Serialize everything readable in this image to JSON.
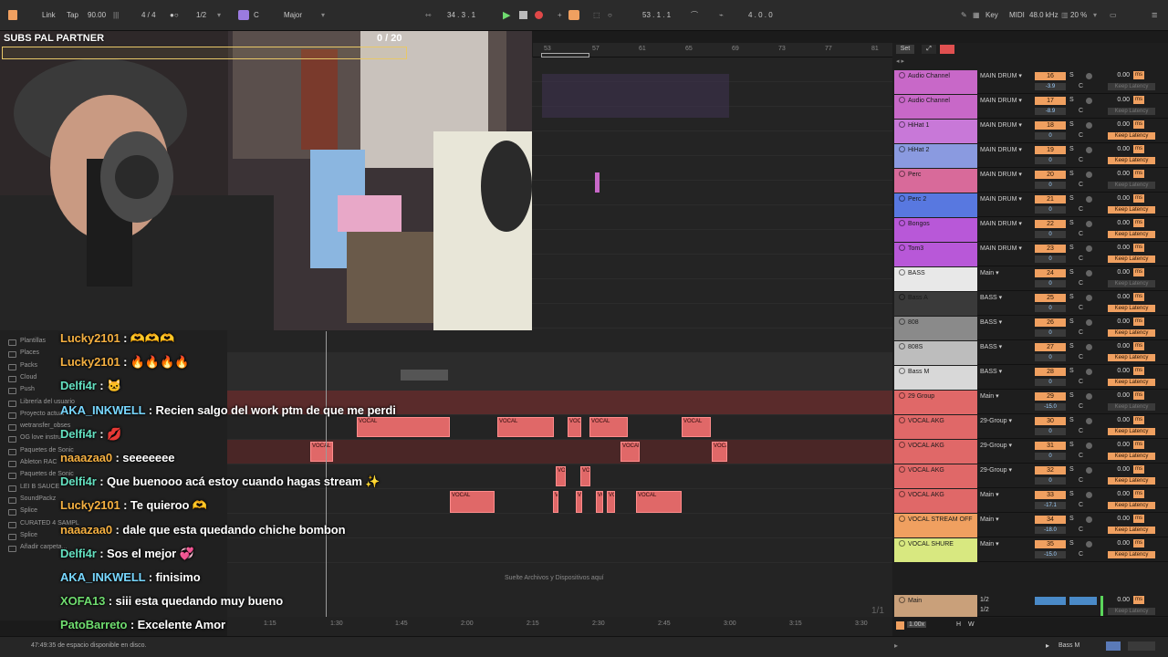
{
  "transport": {
    "link": "Link",
    "tap": "Tap",
    "tempo": "90.00",
    "signature": "4 / 4",
    "quantize": "1/2",
    "key_root": "C",
    "key_scale": "Major",
    "position": "34 .  3 .  1",
    "loop_start": "53 .  1 .  1",
    "loop_length": "4 .  0 .  0",
    "key_label": "Key",
    "midi_label": "MIDI",
    "sample_rate": "48.0 kHz",
    "cpu": "20 %"
  },
  "overlay": {
    "subs_goal": "SUBS PAL PARTNER",
    "subs_count": "0 / 20"
  },
  "ruler": [
    "53",
    "57",
    "61",
    "65",
    "69",
    "73",
    "77",
    "81"
  ],
  "set_label": "Set",
  "browser": {
    "items": [
      "Plantillas",
      "Places",
      "Packs",
      "Cloud",
      "Push",
      "Librería del usuario",
      "Proyecto actual",
      "wetransfer_obses",
      "OG love instru",
      "Paquetes de Sonic",
      "Ableton RAC",
      "Paquetes de Sonic",
      "LEI B SAUCE",
      "SoundPackz",
      "Splice",
      "CURATED 4 SAMPL",
      "Splice",
      "Añadir carpeta..."
    ]
  },
  "chat": [
    {
      "user": "Lucky2101",
      "msg": " : 🫶🫶🫶",
      "color": "o"
    },
    {
      "user": "Lucky2101",
      "msg": " : 🔥🔥🔥🔥",
      "color": "o"
    },
    {
      "user": "Delfi4r",
      "msg": " : 🐱",
      "color": "t"
    },
    {
      "user": "AKA_INKWELL",
      "msg": " : Recien salgo del work ptm de que me perdi",
      "color": ""
    },
    {
      "user": "Delfi4r",
      "msg": " : 💋",
      "color": "t"
    },
    {
      "user": "naaazaa0",
      "msg": " : seeeeeee",
      "color": "o"
    },
    {
      "user": "Delfi4r",
      "msg": " : Que buenooo acá estoy cuando hagas stream ✨",
      "color": "t"
    },
    {
      "user": "Lucky2101",
      "msg": " : Te quieroo 🫶",
      "color": "o"
    },
    {
      "user": "naaazaa0",
      "msg": " : dale que esta quedando chiche bombon",
      "color": "o"
    },
    {
      "user": "Delfi4r",
      "msg": " : Sos el mejor 💞",
      "color": "t"
    },
    {
      "user": "AKA_INKWELL",
      "msg": " : finisimo",
      "color": ""
    },
    {
      "user": "XOFA13",
      "msg": " : siii esta quedando muy bueno",
      "color": "g"
    },
    {
      "user": "PatoBarreto",
      "msg": " : Excelente Amor",
      "color": "g"
    }
  ],
  "tracks": [
    {
      "name": "Audio Channel",
      "color": "#c868c8",
      "route": "MAIN DRUM",
      "num": "16",
      "sub": "-3.9",
      "vol": "0.00",
      "latency": "Keep Latency",
      "klon": false
    },
    {
      "name": "Audio Channel",
      "color": "#c868c8",
      "route": "MAIN DRUM",
      "num": "17",
      "sub": "-8.9",
      "vol": "0.00",
      "latency": "Keep Latency",
      "klon": false
    },
    {
      "name": "HiHat 1",
      "color": "#c878d8",
      "route": "MAIN DRUM",
      "num": "18",
      "sub": "0",
      "vol": "0.00",
      "latency": "Keep Latency",
      "klon": true
    },
    {
      "name": "HiHat 2",
      "color": "#8a9ae0",
      "route": "MAIN DRUM",
      "num": "19",
      "sub": "0",
      "vol": "0.00",
      "latency": "Keep Latency",
      "klon": true
    },
    {
      "name": "Perc",
      "color": "#d86a9a",
      "route": "MAIN DRUM",
      "num": "20",
      "sub": "0",
      "vol": "0.00",
      "latency": "Keep Latency",
      "klon": false
    },
    {
      "name": "Perc 2",
      "color": "#5878e0",
      "route": "MAIN DRUM",
      "num": "21",
      "sub": "0",
      "vol": "0.00",
      "latency": "Keep Latency",
      "klon": true
    },
    {
      "name": "Bongos",
      "color": "#b858d8",
      "route": "MAIN DRUM",
      "num": "22",
      "sub": "0",
      "vol": "0.00",
      "latency": "Keep Latency",
      "klon": true
    },
    {
      "name": "Tom3",
      "color": "#b858d8",
      "route": "MAIN DRUM",
      "num": "23",
      "sub": "0",
      "vol": "0.00",
      "latency": "Keep Latency",
      "klon": true
    },
    {
      "name": "BASS",
      "color": "#e8e8e8",
      "route": "Main",
      "num": "24",
      "sub": "0",
      "vol": "0.00",
      "latency": "Keep Latency",
      "klon": false
    },
    {
      "name": "Bass A",
      "color": "#3a3a3a",
      "route": "BASS",
      "num": "25",
      "sub": "0",
      "vol": "0.00",
      "latency": "Keep Latency",
      "klon": true
    },
    {
      "name": "808",
      "color": "#8a8a8a",
      "route": "BASS",
      "num": "26",
      "sub": "0",
      "vol": "0.00",
      "latency": "Keep Latency",
      "klon": true
    },
    {
      "name": "808S",
      "color": "#bdbdbd",
      "route": "BASS",
      "num": "27",
      "sub": "0",
      "vol": "0.00",
      "latency": "Keep Latency",
      "klon": true
    },
    {
      "name": "Bass M",
      "color": "#d8d8d8",
      "route": "BASS",
      "num": "28",
      "sub": "0",
      "vol": "0.00",
      "latency": "Keep Latency",
      "klon": true
    },
    {
      "name": "29 Group",
      "color": "#e06868",
      "route": "Main",
      "num": "29",
      "sub": "-15.0",
      "vol": "0.00",
      "latency": "Keep Latency",
      "klon": false
    },
    {
      "name": "VOCAL AKG",
      "color": "#e06868",
      "route": "29-Group",
      "num": "30",
      "sub": "0",
      "vol": "0.00",
      "latency": "Keep Latency",
      "klon": true
    },
    {
      "name": "VOCAL AKG",
      "color": "#e06868",
      "route": "29-Group",
      "num": "31",
      "sub": "0",
      "vol": "0.00",
      "latency": "Keep Latency",
      "klon": true
    },
    {
      "name": "VOCAL AKG",
      "color": "#e06868",
      "route": "29-Group",
      "num": "32",
      "sub": "0",
      "vol": "0.00",
      "latency": "Keep Latency",
      "klon": true
    },
    {
      "name": "VOCAL AKG",
      "color": "#e06868",
      "route": "Main",
      "num": "33",
      "sub": "-17.1",
      "vol": "0.00",
      "latency": "Keep Latency",
      "klon": true
    },
    {
      "name": "VOCAL STREAM OFF",
      "color": "#f0a060",
      "route": "Main",
      "num": "34",
      "sub": "-18.0",
      "vol": "0.00",
      "latency": "Keep Latency",
      "klon": true
    },
    {
      "name": "VOCAL SHURE",
      "color": "#d8e880",
      "route": "Main",
      "num": "35",
      "sub": "-15.0",
      "vol": "0.00",
      "latency": "Keep Latency",
      "klon": true
    }
  ],
  "master": {
    "name": "Main",
    "route_a": "1/2",
    "route_b": "1/2",
    "vol": "0.00",
    "latency": "Keep Latency",
    "zoom": "1.00x"
  },
  "drop_hint": "Suelte Archivos y Dispositivos aquí",
  "page_fraction": "1/1",
  "timeline": [
    "1:15",
    "1:30",
    "1:45",
    "2:00",
    "2:15",
    "2:30",
    "2:45",
    "3:00",
    "3:15",
    "3:30"
  ],
  "clip_label": "VOCAL",
  "status": {
    "disk": "47:49:35 de espacio disponible en disco.",
    "track": "Bass M"
  }
}
